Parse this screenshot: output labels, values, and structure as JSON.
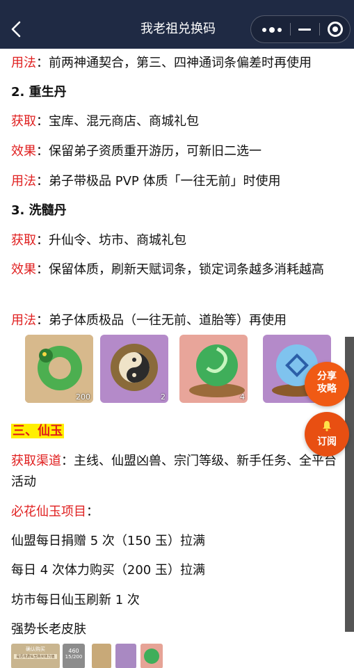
{
  "header": {
    "title": "我老祖兑换码"
  },
  "content": {
    "l1_label": "用法",
    "l1_text": "：前两神通契合，第三、四神通词条偏差时再使用",
    "h2": "2. 重生丹",
    "l2_label": "获取",
    "l2_text": "：宝库、混元商店、商城礼包",
    "l3_label": "效果",
    "l3_text": "：保留弟子资质重开游历，可新旧二选一",
    "l4_label": "用法",
    "l4_text": "：弟子带极品 PVP 体质「一往无前」时使用",
    "h3": "3. 洗髓丹",
    "l5_label": "获取",
    "l5_text": "：升仙令、坊市、商城礼包",
    "l6_label": "效果",
    "l6_text": "：保留体质，刷新天赋词条，锁定词条越多消耗越高",
    "l7_label": "用法",
    "l7_text": "：弟子体质极品（一往无前、道胎等）再使用",
    "items": [
      {
        "icon": "jade-dragon-ring-icon",
        "count": "200"
      },
      {
        "icon": "yin-yang-ring-icon",
        "count": "2"
      },
      {
        "icon": "green-vortex-pill-icon",
        "count": "4"
      },
      {
        "icon": "blue-crystal-orb-icon",
        "count": ""
      }
    ],
    "section_title": "三、仙玉",
    "l8_label": "获取渠道",
    "l8_text": "：主线、仙盟凶兽、宗门等级、新手任务、全平台活动",
    "l9_label": "必花仙玉项目",
    "l9_text": "：",
    "l10": "仙盟每日捐赠 5 次（150 玉）拉满",
    "l11": "每日 4 次体力购买（200 玉）拉满",
    "l12": "坊市每日仙玉刷新 1 次",
    "l13": "强势长老皮肤",
    "thumbs": [
      {
        "name": "thumb-confirm-purchase",
        "caption": "确认购买",
        "sub": "是否花费仙玉购买体力值"
      },
      {
        "name": "thumb-counter",
        "caption": "460",
        "sub": "15/200"
      },
      {
        "name": "thumb-scroll",
        "caption": "",
        "sub": ""
      },
      {
        "name": "thumb-purple-item",
        "caption": "",
        "sub": ""
      },
      {
        "name": "thumb-green-item",
        "caption": "",
        "sub": ""
      }
    ]
  },
  "fabs": {
    "share_line1": "分享",
    "share_line2": "攻略",
    "subscribe": "订阅"
  },
  "colors": {
    "topbar": "#1f2a44",
    "label_red": "#e02020",
    "highlight_yellow": "#ffef00",
    "fab_orange": "#f05a14"
  }
}
